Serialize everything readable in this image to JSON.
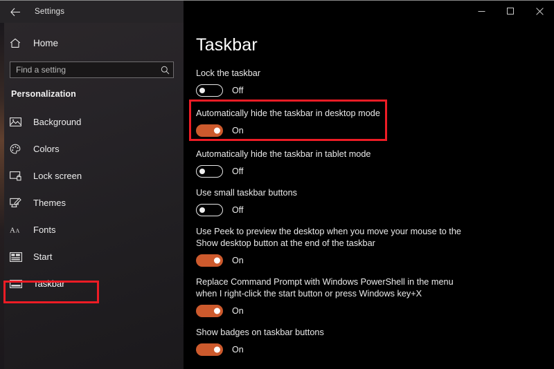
{
  "window": {
    "app_title": "Settings",
    "back_icon": "back-arrow-icon",
    "controls": {
      "minimize_label": "Minimize",
      "maximize_label": "Maximize",
      "close_label": "Close"
    }
  },
  "sidebar": {
    "home": {
      "label": "Home",
      "icon": "home-icon"
    },
    "search": {
      "placeholder": "Find a setting",
      "value": "",
      "icon": "search-icon"
    },
    "section_title": "Personalization",
    "items": [
      {
        "label": "Background",
        "icon": "image-icon",
        "selected": false
      },
      {
        "label": "Colors",
        "icon": "palette-icon",
        "selected": false
      },
      {
        "label": "Lock screen",
        "icon": "lock-screen-icon",
        "selected": false
      },
      {
        "label": "Themes",
        "icon": "themes-icon",
        "selected": false
      },
      {
        "label": "Fonts",
        "icon": "fonts-icon",
        "selected": false
      },
      {
        "label": "Start",
        "icon": "start-icon",
        "selected": false
      },
      {
        "label": "Taskbar",
        "icon": "taskbar-icon",
        "selected": true
      }
    ]
  },
  "main": {
    "page_title": "Taskbar",
    "settings": [
      {
        "label": "Lock the taskbar",
        "state": "Off",
        "on": false,
        "highlighted": false
      },
      {
        "label": "Automatically hide the taskbar in desktop mode",
        "state": "On",
        "on": true,
        "highlighted": true
      },
      {
        "label": "Automatically hide the taskbar in tablet mode",
        "state": "Off",
        "on": false,
        "highlighted": false
      },
      {
        "label": "Use small taskbar buttons",
        "state": "Off",
        "on": false,
        "highlighted": false
      },
      {
        "label": "Use Peek to preview the desktop when you move your mouse to the Show desktop button at the end of the taskbar",
        "state": "On",
        "on": true,
        "highlighted": false
      },
      {
        "label": "Replace Command Prompt with Windows PowerShell in the menu when I right-click the start button or press Windows key+X",
        "state": "On",
        "on": true,
        "highlighted": false
      },
      {
        "label": "Show badges on taskbar buttons",
        "state": "On",
        "on": true,
        "highlighted": false
      }
    ]
  },
  "annotations": {
    "highlight_color": "#ee1c25",
    "nav_highlight_target": "Taskbar",
    "setting_highlight_target": "Automatically hide the taskbar in desktop mode"
  },
  "colors": {
    "accent": "#cd5a2d",
    "content_background": "#000000",
    "sidebar_background": "#272428"
  }
}
